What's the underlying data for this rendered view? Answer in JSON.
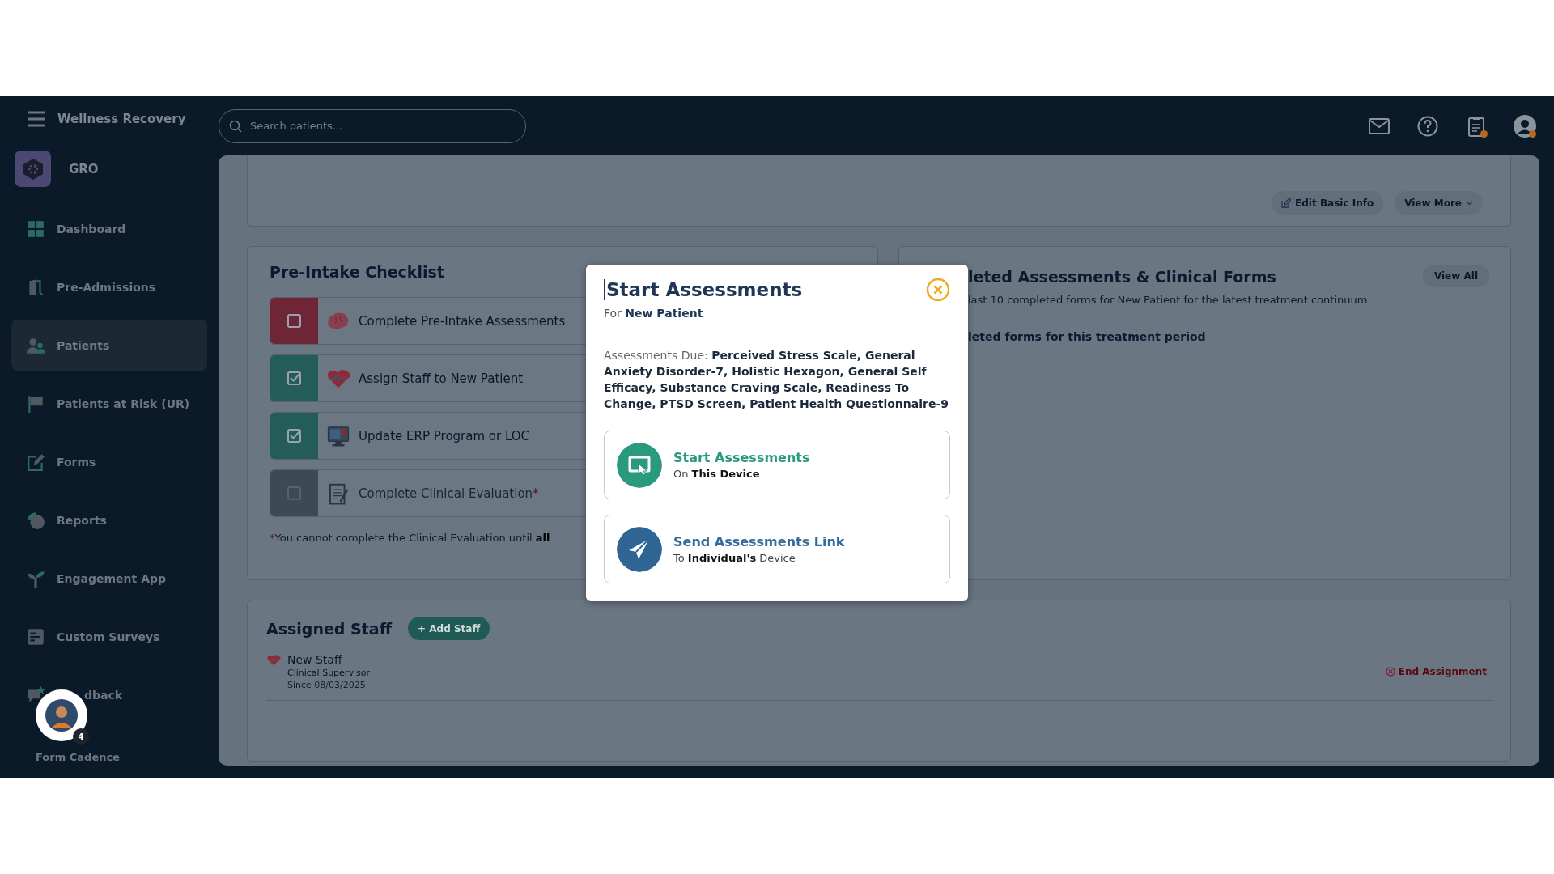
{
  "app": {
    "org": "Wellness Recovery",
    "workspace": "GRO"
  },
  "search": {
    "placeholder": "Search patients..."
  },
  "header_icons": [
    {
      "kind": "mail",
      "dot": false
    },
    {
      "kind": "help",
      "dot": false
    },
    {
      "kind": "clipboard",
      "dot": true
    },
    {
      "kind": "user",
      "dot": true
    }
  ],
  "sidebar": {
    "items": [
      {
        "label": "Dashboard",
        "selected": false
      },
      {
        "label": "Pre-Admissions",
        "selected": false
      },
      {
        "label": "Patients",
        "selected": true
      },
      {
        "label": "Patients at Risk (UR)",
        "selected": false
      },
      {
        "label": "Forms",
        "selected": false
      },
      {
        "label": "Reports",
        "selected": false
      },
      {
        "label": "Engagement App",
        "selected": false
      },
      {
        "label": "Custom Surveys",
        "selected": false
      },
      {
        "label": "dback",
        "selected": false
      }
    ]
  },
  "assistant": {
    "badge": "4",
    "label": "Form Cadence"
  },
  "patient_card": {
    "buttons": [
      "Edit Basic Info",
      "View More"
    ]
  },
  "checklist": {
    "title": "Pre-Intake Checklist",
    "items": [
      {
        "label": "Complete Pre-Intake Assessments",
        "checked": false,
        "disabled": false,
        "required": false
      },
      {
        "label": "Assign Staff to New Patient",
        "checked": true,
        "disabled": false,
        "required": false
      },
      {
        "label": "Update ERP Program or LOC",
        "checked": true,
        "disabled": false,
        "required": false
      },
      {
        "label": "Complete Clinical Evaluation",
        "checked": false,
        "disabled": true,
        "required": true
      }
    ],
    "note_mark": "*",
    "note": "You cannot complete the Clinical Evaluation until **all**"
  },
  "completed_forms": {
    "title": "leted Assessments & Clinical Forms",
    "button": "View All",
    "description": "last 10 completed forms for New Patient for the latest treatment continuum.",
    "empty_text": "leted forms for this treatment period"
  },
  "assigned_staff": {
    "title": "Assigned Staff",
    "add_button": "+ Add Staff",
    "staff": [
      {
        "name": "New Staff",
        "role": "Clinical Supervisor",
        "since": "Since 08/03/2025",
        "action": "End Assignment"
      }
    ]
  },
  "modal": {
    "title": "Start Assessments",
    "subtitle": "For **New Patient**",
    "due": "Assessments Due: **Perceived Stress Scale, General Anxiety Disorder-7, Holistic Hexagon, General Self Efficacy, Substance Craving Scale, Readiness To Change, PTSD Screen, Patient Health Questionnaire-9**",
    "options": [
      {
        "kind": "device",
        "title": "Start Assessments",
        "subtitle": "On **This Device**"
      },
      {
        "kind": "link",
        "title": "Send Assessments Link",
        "subtitle": "To **Individual's** Device"
      }
    ]
  }
}
